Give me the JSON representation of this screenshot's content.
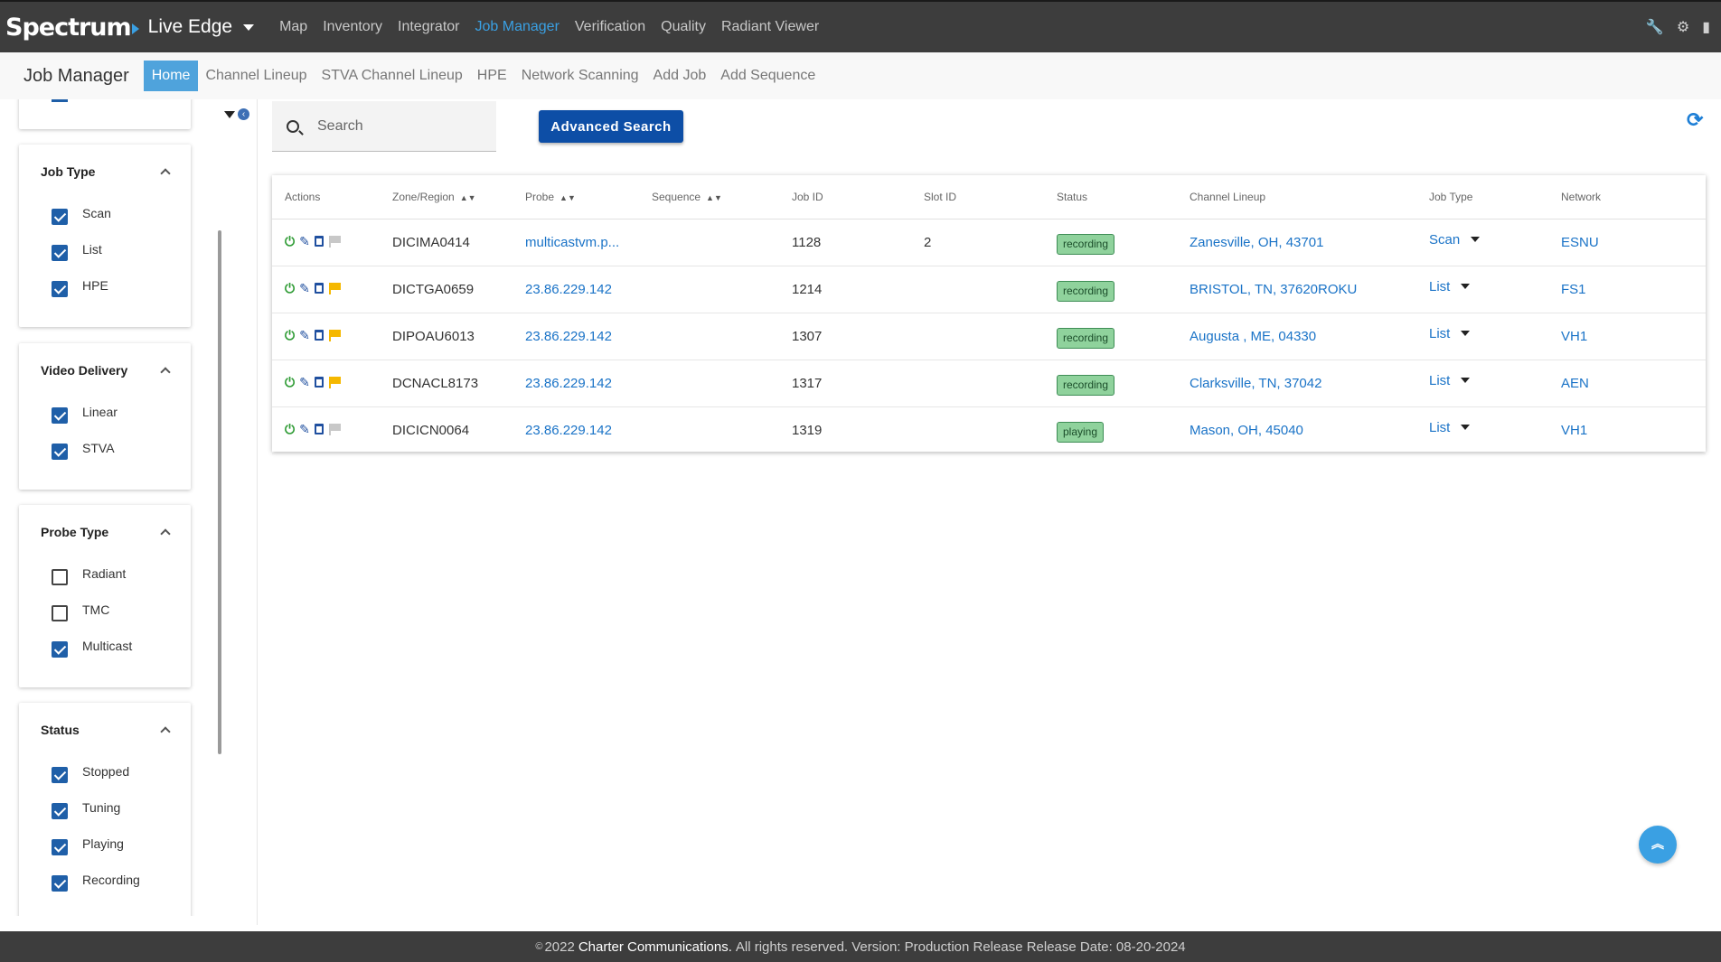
{
  "topbar": {
    "logo": "Spectrum",
    "app_name": "Live Edge",
    "nav": [
      "Map",
      "Inventory",
      "Integrator",
      "Job Manager",
      "Verification",
      "Quality",
      "Radiant Viewer"
    ],
    "active_nav": "Job Manager",
    "icons": [
      "wrench-icon",
      "gear-icon",
      "book-icon"
    ],
    "accent": "#3aa0e3"
  },
  "subbar": {
    "title": "Job Manager",
    "tabs": [
      "Home",
      "Channel Lineup",
      "STVA Channel Lineup",
      "HPE",
      "Network Scanning",
      "Add Job",
      "Add Sequence"
    ],
    "active_tab": "Home"
  },
  "filters": {
    "job_type": {
      "title": "Job Type",
      "options": [
        {
          "label": "Scan",
          "checked": true
        },
        {
          "label": "List",
          "checked": true
        },
        {
          "label": "HPE",
          "checked": true
        }
      ]
    },
    "video_delivery": {
      "title": "Video Delivery",
      "options": [
        {
          "label": "Linear",
          "checked": true
        },
        {
          "label": "STVA",
          "checked": true
        }
      ]
    },
    "probe_type": {
      "title": "Probe Type",
      "options": [
        {
          "label": "Radiant",
          "checked": false
        },
        {
          "label": "TMC",
          "checked": false
        },
        {
          "label": "Multicast",
          "checked": true
        }
      ]
    },
    "status": {
      "title": "Status",
      "options": [
        {
          "label": "Stopped",
          "checked": true
        },
        {
          "label": "Tuning",
          "checked": true
        },
        {
          "label": "Playing",
          "checked": true
        },
        {
          "label": "Recording",
          "checked": true
        }
      ]
    }
  },
  "search": {
    "placeholder": "Search",
    "value": "",
    "advanced_label": "Advanced Search"
  },
  "table": {
    "headers": [
      "Actions",
      "Zone/Region",
      "Probe",
      "Sequence",
      "Job ID",
      "Slot ID",
      "Status",
      "Channel Lineup",
      "Job Type",
      "Network"
    ],
    "rows": [
      {
        "zone": "DICIMA0414",
        "probe": "multicastvm.p...",
        "sequence": "",
        "job_id": "1128",
        "slot_id": "2",
        "status": "recording",
        "lineup": "Zanesville, OH, 43701",
        "job_type": "Scan",
        "network": "ESNU",
        "flag": "grey"
      },
      {
        "zone": "DICTGA0659",
        "probe": "23.86.229.142",
        "sequence": "",
        "job_id": "1214",
        "slot_id": "",
        "status": "recording",
        "lineup": "BRISTOL, TN, 37620ROKU",
        "job_type": "List",
        "network": "FS1",
        "flag": "yellow"
      },
      {
        "zone": "DIPOAU6013",
        "probe": "23.86.229.142",
        "sequence": "",
        "job_id": "1307",
        "slot_id": "",
        "status": "recording",
        "lineup": "Augusta , ME, 04330",
        "job_type": "List",
        "network": "VH1",
        "flag": "yellow"
      },
      {
        "zone": "DCNACL8173",
        "probe": "23.86.229.142",
        "sequence": "",
        "job_id": "1317",
        "slot_id": "",
        "status": "recording",
        "lineup": "Clarksville, TN, 37042",
        "job_type": "List",
        "network": "AEN",
        "flag": "yellow"
      },
      {
        "zone": "DICICN0064",
        "probe": "23.86.229.142",
        "sequence": "",
        "job_id": "1319",
        "slot_id": "",
        "status": "playing",
        "lineup": "Mason, OH, 45040",
        "job_type": "List",
        "network": "VH1",
        "flag": "grey"
      }
    ]
  },
  "footer": {
    "symbol": "©",
    "year": "2022",
    "company": "Charter Communications.",
    "text": "All rights reserved. Version: Production Release Release Date: 08-20-2024"
  }
}
